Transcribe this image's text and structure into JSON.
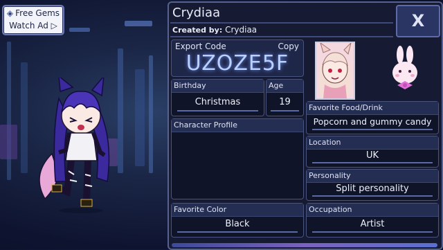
{
  "gems_button": {
    "line1": "Free Gems",
    "line2": "Watch Ad ▷",
    "icon": "diamond-icon"
  },
  "character": {
    "name": "Crydiaa",
    "created_by_label": "Created by:",
    "created_by": "Crydiaa"
  },
  "close_button": {
    "label": "X"
  },
  "export": {
    "label": "Export Code",
    "copy_label": "Copy",
    "code": "UZOZE5F"
  },
  "birthday": {
    "label": "Birthday",
    "value": "Christmas"
  },
  "age": {
    "label": "Age",
    "value": "19"
  },
  "profile": {
    "label": "Character Profile",
    "value": ""
  },
  "favorite_color": {
    "label": "Favorite Color",
    "value": "Black"
  },
  "favorite_food": {
    "label": "Favorite Food/Drink",
    "value": "Popcorn and gummy candy"
  },
  "location": {
    "label": "Location",
    "value": "UK"
  },
  "personality": {
    "label": "Personality",
    "value": "Split personality"
  },
  "occupation": {
    "label": "Occupation",
    "value": "Artist"
  },
  "colors": {
    "panel_bg": "#161b33",
    "panel_border": "#56628f",
    "code_glow": "#b9d1ff",
    "hair": "#3b2a9e",
    "tail": "#e8a9d8"
  }
}
